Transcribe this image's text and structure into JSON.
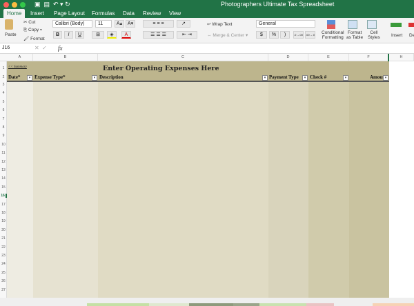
{
  "window": {
    "title": "Photographers Ultimate Tax Spreadsheet"
  },
  "tabs": [
    "Home",
    "Insert",
    "Page Layout",
    "Formulas",
    "Data",
    "Review",
    "View"
  ],
  "ribbon": {
    "paste": "Paste",
    "cut": "Cut",
    "copy": "Copy",
    "format": "Format",
    "font": "Calibri (Body)",
    "size": "11",
    "bold": "B",
    "italic": "I",
    "underline": "U",
    "wrap": "Wrap Text",
    "merge": "Merge & Center",
    "number_format": "General",
    "currency": "$",
    "percent": "%",
    "comma": ")",
    "inc_dec": ".0→.00",
    "dec_dec": ".00→.0",
    "cond1": "Conditional",
    "cond2": "Formatting",
    "fmt1": "Format",
    "fmt2": "as Table",
    "cell1": "Cell",
    "cell2": "Styles",
    "insert": "Insert",
    "delete": "De"
  },
  "formula_bar": {
    "cell_ref": "J16",
    "fx": "fx",
    "value": ""
  },
  "columns": [
    "A",
    "B",
    "C",
    "D",
    "E",
    "F",
    "H"
  ],
  "rows": [
    "1",
    "2",
    "3",
    "4",
    "5",
    "6",
    "7",
    "8",
    "9",
    "10",
    "11",
    "12",
    "13",
    "14",
    "15",
    "16",
    "17",
    "18",
    "19",
    "20",
    "21",
    "22",
    "23",
    "24",
    "25",
    "26",
    "27"
  ],
  "sheet": {
    "link": "<< Summary",
    "heading": "Enter Operating Expenses Here",
    "headers": [
      "Date*",
      "Expense Type*",
      "Description",
      "Payment Type",
      "Check #",
      "Amount"
    ],
    "selected_row": "16"
  }
}
